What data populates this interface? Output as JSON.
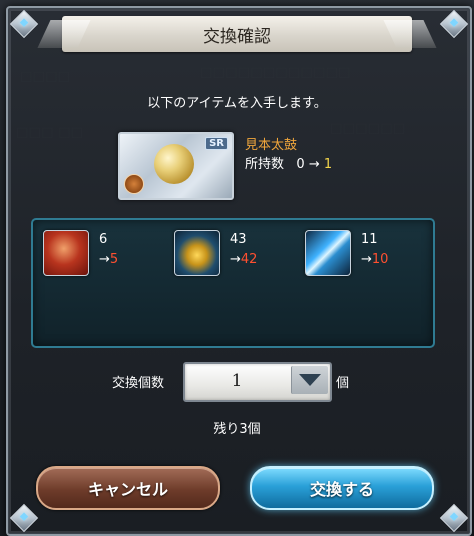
{
  "dialog": {
    "title": "交換確認",
    "intro": "以下のアイテムを入手します。"
  },
  "item": {
    "name": "見本太鼓",
    "owned_label": "所持数",
    "owned_before": "0",
    "arrow": "→",
    "owned_after": "1",
    "rarity": "SR",
    "icon": "golden-bell-icon"
  },
  "costs": [
    {
      "icon": "red-scroll-icon",
      "count": "6",
      "arrow": "→",
      "remaining": "5"
    },
    {
      "icon": "gold-orb-icon",
      "count": "43",
      "arrow": "→",
      "remaining": "42"
    },
    {
      "icon": "blue-crystal-shards-icon",
      "count": "11",
      "arrow": "→",
      "remaining": "10"
    }
  ],
  "quantity": {
    "label": "交換個数",
    "value": "1",
    "unit": "個",
    "dropdown_icon": "chevron-down-icon"
  },
  "remaining_text": "残り3個",
  "buttons": {
    "cancel": "キャンセル",
    "confirm": "交換する"
  },
  "colors": {
    "item_name": "#f0a63c",
    "owned_after": "#f3d54a",
    "cost_remaining": "#ff5030",
    "confirm_button": "#2aa0d8",
    "cancel_button": "#6e3c2a",
    "panel_border": "#2f7b92"
  }
}
